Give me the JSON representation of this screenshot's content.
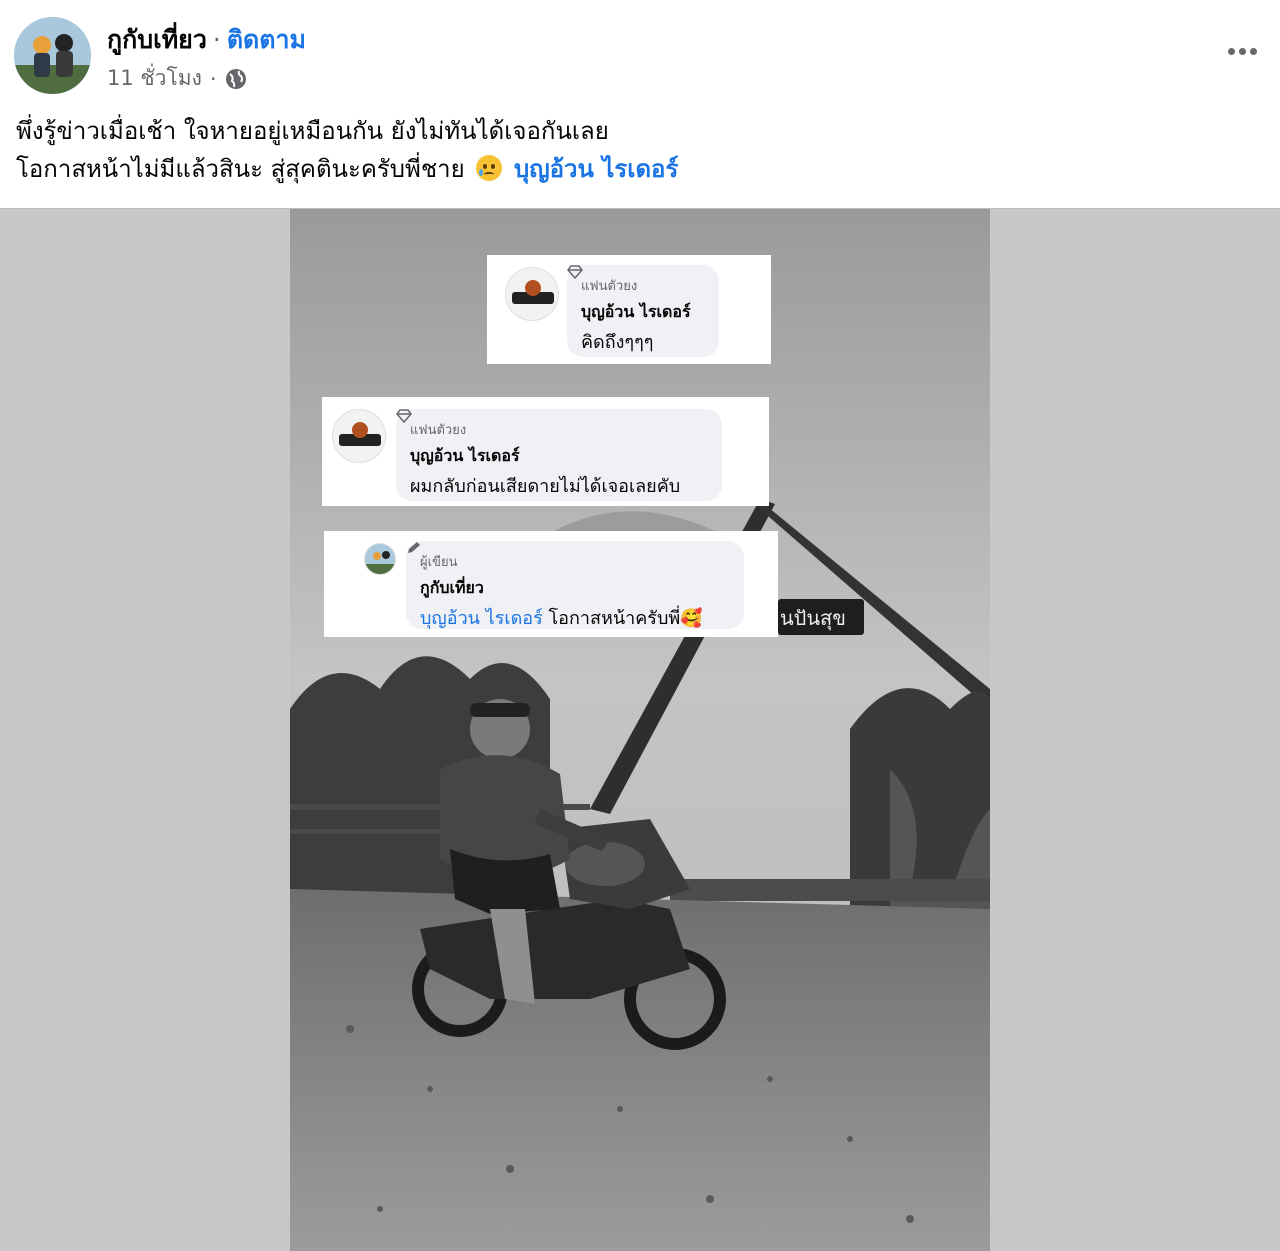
{
  "post": {
    "author": "กูกับเที่ยว",
    "separator": "·",
    "follow_label": "ติดตาม",
    "time": "11 ชั่วโมง",
    "privacy_icon": "globe-icon",
    "more_icon": "more-options-icon",
    "text_line1": "พึ่งรู้ข่าวเมื่อเช้า ใจหายอยู่เหมือนกัน ยังไม่ทันได้เจอกันเลย",
    "text_line2": "โอกาสหน้าไม่มีแล้วสินะ สู่สุคตินะครับพี่ชาย",
    "emoji": "sad-tear-emoji",
    "mention": "บุญอ้วน ไรเดอร์"
  },
  "comments": [
    {
      "badge_icon": "diamond-icon",
      "badge": "แฟนตัวยง",
      "name": "บุญอ้วน ไรเดอร์",
      "text": "คิดถึงๆๆๆ"
    },
    {
      "badge_icon": "diamond-icon",
      "badge": "แฟนตัวยง",
      "name": "บุญอ้วน ไรเดอร์",
      "text": "ผมกลับก่อนเสียดายไม่ได้เจอเลยคับ"
    },
    {
      "badge_icon": "pencil-icon",
      "badge": "ผู้เขียน",
      "name": "กูกับเที่ยว",
      "mention": "บุญอ้วน ไรเดอร์",
      "text": "โอกาสหน้าครับพี่🥰"
    }
  ],
  "photo": {
    "sign_text": "นปันสุข"
  },
  "colors": {
    "link": "#1b74e4",
    "muted": "#65676b",
    "bubble": "#eff1f5",
    "media_bg": "#c8c8c8"
  }
}
